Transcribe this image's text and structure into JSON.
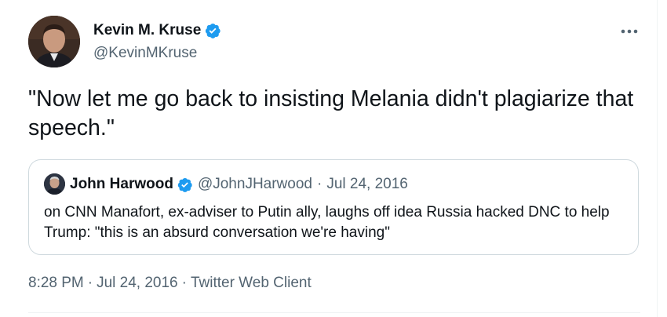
{
  "tweet": {
    "author": {
      "display_name": "Kevin M. Kruse",
      "handle": "@KevinMKruse",
      "verified": true
    },
    "text": "\"Now let me go back to insisting Melania didn't plagiarize that speech.\"",
    "quoted": {
      "display_name": "John Harwood",
      "handle": "@JohnJHarwood",
      "dot": "·",
      "date": "Jul 24, 2016",
      "verified": true,
      "text": "on CNN Manafort, ex-adviser to Putin ally, laughs off idea Russia hacked DNC to help Trump: \"this is an absurd conversation we're having\""
    },
    "time": "8:28 PM",
    "date": "Jul 24, 2016",
    "client": "Twitter Web Client",
    "separator": "·"
  },
  "icons": {
    "verified": "verified-badge-icon",
    "more": "more-horizontal-icon"
  },
  "colors": {
    "verified_blue": "#1d9bf0",
    "text_primary": "#0f1419",
    "text_secondary": "#536471",
    "border": "#cfd9de"
  }
}
